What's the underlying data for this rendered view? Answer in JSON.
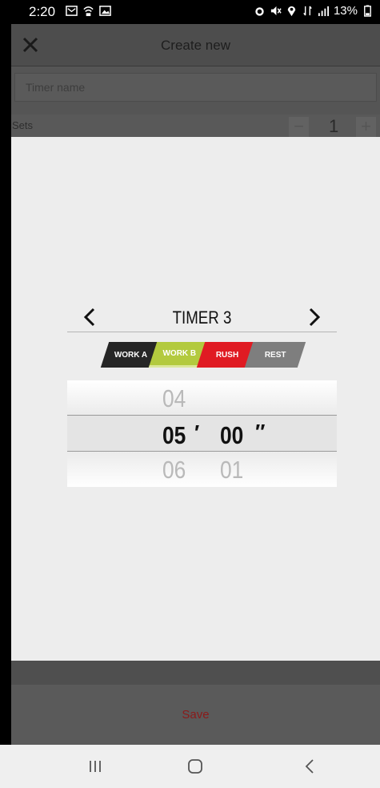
{
  "status_bar": {
    "time": "2:20",
    "battery": "13%"
  },
  "header": {
    "title": "Create new",
    "close_icon": "close-icon"
  },
  "form": {
    "name_placeholder": "Timer name",
    "sets_label": "Sets",
    "sets_value": "1",
    "minus_label": "−",
    "plus_label": "+"
  },
  "timer_dialog": {
    "title": "TIMER 3",
    "tabs": [
      {
        "label": "WORK A",
        "color": "#262626"
      },
      {
        "label": "WORK B",
        "color": "#b3ca3e"
      },
      {
        "label": "RUSH",
        "color": "#e01b23"
      },
      {
        "label": "REST",
        "color": "#7e7e7e"
      }
    ],
    "selected_tab": "WORK B",
    "picker": {
      "minutes_prev": "04",
      "minutes": "05",
      "minutes_next": "06",
      "seconds": "00",
      "seconds_next": "01",
      "minute_mark": "′",
      "second_mark": "″"
    }
  },
  "footer": {
    "save_label": "Save",
    "save_color": "#8b1a1a"
  },
  "colors": {
    "accent_work_b": "#b3ca3e",
    "accent_rush": "#e01b23"
  }
}
